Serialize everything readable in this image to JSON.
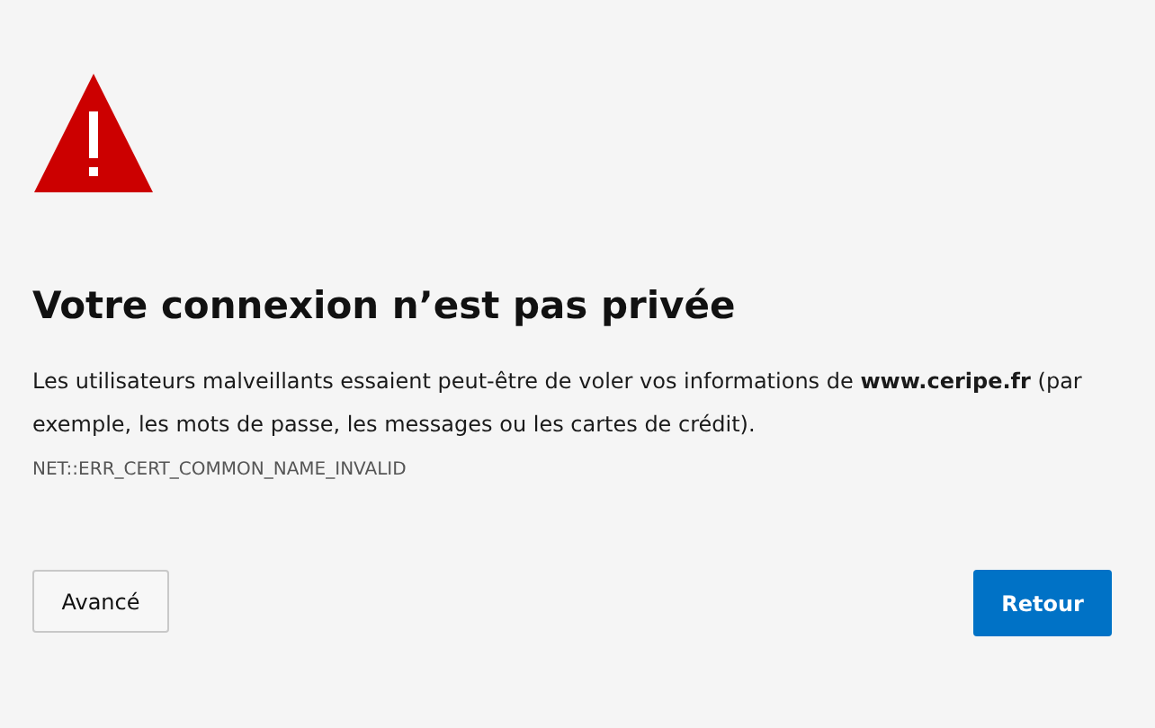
{
  "heading": "Votre connexion n’est pas privée",
  "message": "Les utilisateurs malveillants essaient peut-être de voler vos informations de **www.ceripe.fr** (par exemple, les mots de passe, les messages ou les cartes de crédit).",
  "error_code": "NET::ERR_CERT_COMMON_NAME_INVALID",
  "buttons": [
    {
      "label": "Avancé",
      "kind": "secondary"
    },
    {
      "label": "Retour",
      "kind": "primary"
    }
  ]
}
